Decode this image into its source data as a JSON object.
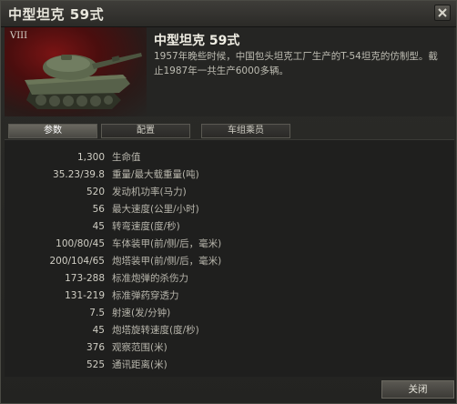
{
  "window": {
    "title": "中型坦克 59式"
  },
  "vehicle": {
    "tier": "VIII",
    "name": "中型坦克 59式",
    "description": "1957年晚些时候，中国包头坦克工厂生产的T-54坦克的仿制型。截止1987年一共生产6000多辆。"
  },
  "tabs": [
    {
      "label": "参数",
      "active": true
    },
    {
      "label": "配置",
      "active": false
    },
    {
      "label": "车组乘员",
      "active": false
    }
  ],
  "stats": [
    {
      "value": "1,300",
      "label": "生命值"
    },
    {
      "value": "35.23/39.8",
      "label": "重量/最大载重量(吨)"
    },
    {
      "value": "520",
      "label": "发动机功率(马力)"
    },
    {
      "value": "56",
      "label": "最大速度(公里/小时)"
    },
    {
      "value": "45",
      "label": "转弯速度(度/秒)"
    },
    {
      "value": "100/80/45",
      "label": "车体装甲(前/侧/后，毫米)"
    },
    {
      "value": "200/104/65",
      "label": "炮塔装甲(前/侧/后，毫米)"
    },
    {
      "value": "173-288",
      "label": "标准炮弹的杀伤力"
    },
    {
      "value": "131-219",
      "label": "标准弹药穿透力"
    },
    {
      "value": "7.5",
      "label": "射速(发/分钟)"
    },
    {
      "value": "45",
      "label": "炮塔旋转速度(度/秒)"
    },
    {
      "value": "376",
      "label": "观察范围(米)"
    },
    {
      "value": "525",
      "label": "通讯距离(米)"
    }
  ],
  "footer": {
    "close_label": "关闭"
  },
  "icons": {
    "window_close": "close-icon",
    "vehicle_image": "tank-icon"
  }
}
